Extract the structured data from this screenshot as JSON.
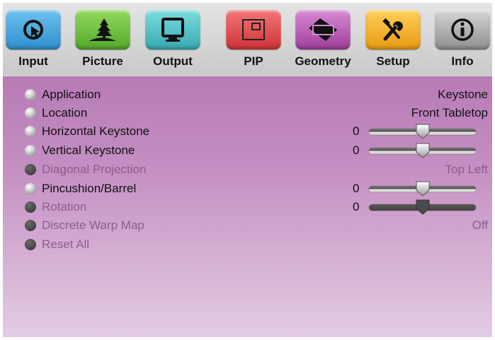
{
  "tabs": [
    {
      "label": "Input",
      "icon": "input-icon",
      "color": "#3a9fd6",
      "active": false
    },
    {
      "label": "Picture",
      "icon": "picture-icon",
      "color": "#69bf3a",
      "active": false
    },
    {
      "label": "Output",
      "icon": "output-monitor-icon",
      "color": "#47bfc4",
      "active": false
    },
    {
      "label": "PIP",
      "icon": "pip-icon",
      "color": "#e0474a",
      "active": false
    },
    {
      "label": "Geometry",
      "icon": "geometry-icon",
      "color": "#b253ad",
      "active": true
    },
    {
      "label": "Setup",
      "icon": "setup-tools-icon",
      "color": "#f0a81e",
      "active": false
    },
    {
      "label": "Info",
      "icon": "info-icon",
      "color": "#a8a8a8",
      "active": false
    }
  ],
  "items": [
    {
      "label": "Application",
      "value": "Keystone",
      "enabled": true
    },
    {
      "label": "Location",
      "value": "Front Tabletop",
      "enabled": true
    },
    {
      "label": "Horizontal Keystone",
      "value": "0",
      "slider": 0.5,
      "enabled": true
    },
    {
      "label": "Vertical Keystone",
      "value": "0",
      "slider": 0.5,
      "enabled": true
    },
    {
      "label": "Diagonal Projection",
      "value": "Top Left",
      "enabled": false
    },
    {
      "label": "Pincushion/Barrel",
      "value": "0",
      "slider": 0.5,
      "enabled": true
    },
    {
      "label": "Rotation",
      "value": "0",
      "slider": 0.5,
      "enabled": false
    },
    {
      "label": "Discrete Warp Map",
      "value": "Off",
      "enabled": false
    },
    {
      "label": "Reset All",
      "enabled": false
    }
  ]
}
